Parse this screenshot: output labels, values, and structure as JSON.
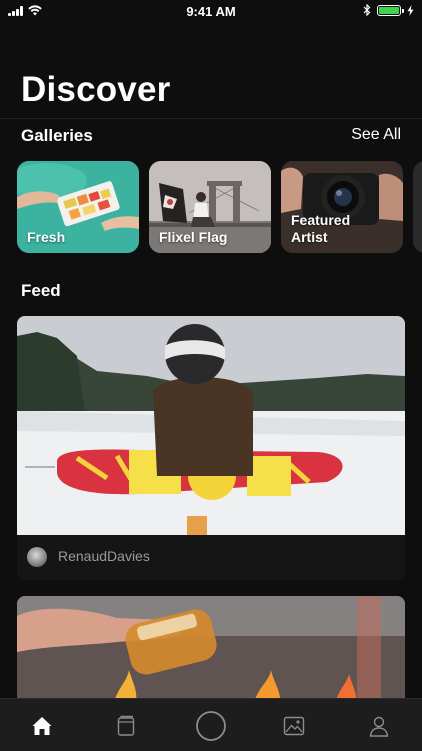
{
  "status_bar": {
    "time": "9:41 AM",
    "battery_color": "#3fd24e"
  },
  "header": {
    "title": "Discover"
  },
  "galleries": {
    "heading": "Galleries",
    "see_all_label": "See All",
    "items": [
      {
        "label": "Fresh"
      },
      {
        "label": "Flixel Flag"
      },
      {
        "label": "Featured Artist"
      }
    ]
  },
  "feed": {
    "heading": "Feed",
    "posts": [
      {
        "author": "RenaudDavies"
      }
    ]
  },
  "tab_bar": {
    "tabs": [
      {
        "icon": "home-icon",
        "active": true
      },
      {
        "icon": "book-icon",
        "active": false
      },
      {
        "icon": "circle-icon",
        "active": false
      },
      {
        "icon": "image-icon",
        "active": false
      },
      {
        "icon": "profile-icon",
        "active": false
      }
    ]
  }
}
